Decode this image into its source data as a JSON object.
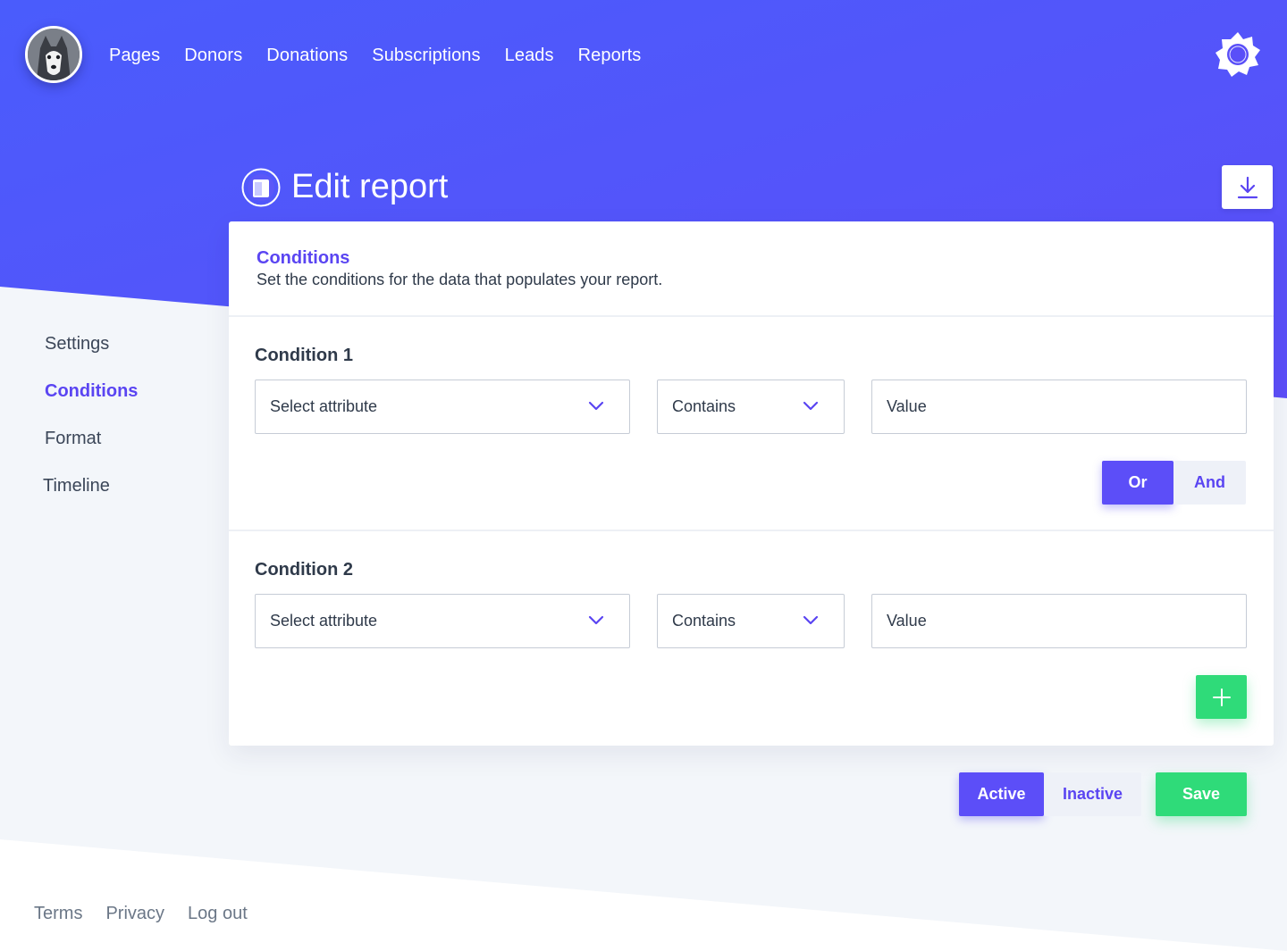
{
  "colors": {
    "brand": "#5a45f2",
    "header_gradient_start": "#4a5cfc",
    "header_gradient_end": "#5c4ef8",
    "success": "#2fdb79",
    "surface": "#f3f6fa"
  },
  "header": {
    "avatar_icon": "husky-avatar",
    "nav": [
      "Pages",
      "Donors",
      "Donations",
      "Subscriptions",
      "Leads",
      "Reports"
    ],
    "settings_icon": "gear-icon"
  },
  "page": {
    "title": "Edit report",
    "title_icon": "report-icon",
    "download_icon": "download-icon"
  },
  "sidebar": {
    "items": [
      "Settings",
      "Conditions",
      "Format",
      "Timeline"
    ],
    "active": "Conditions"
  },
  "card": {
    "heading": "Conditions",
    "subheading": "Set the conditions for the data that populates your report.",
    "conditions": [
      {
        "title": "Condition 1",
        "attribute": "Select attribute",
        "operator": "Contains",
        "value_placeholder": "Value",
        "logic": {
          "or": "Or",
          "and": "And",
          "selected": "Or"
        }
      },
      {
        "title": "Condition 2",
        "attribute": "Select attribute",
        "operator": "Contains",
        "value_placeholder": "Value"
      }
    ],
    "add_icon": "plus-icon"
  },
  "status": {
    "active": "Active",
    "inactive": "Inactive",
    "selected": "Active"
  },
  "save_label": "Save",
  "footer": [
    "Terms",
    "Privacy",
    "Log out"
  ]
}
